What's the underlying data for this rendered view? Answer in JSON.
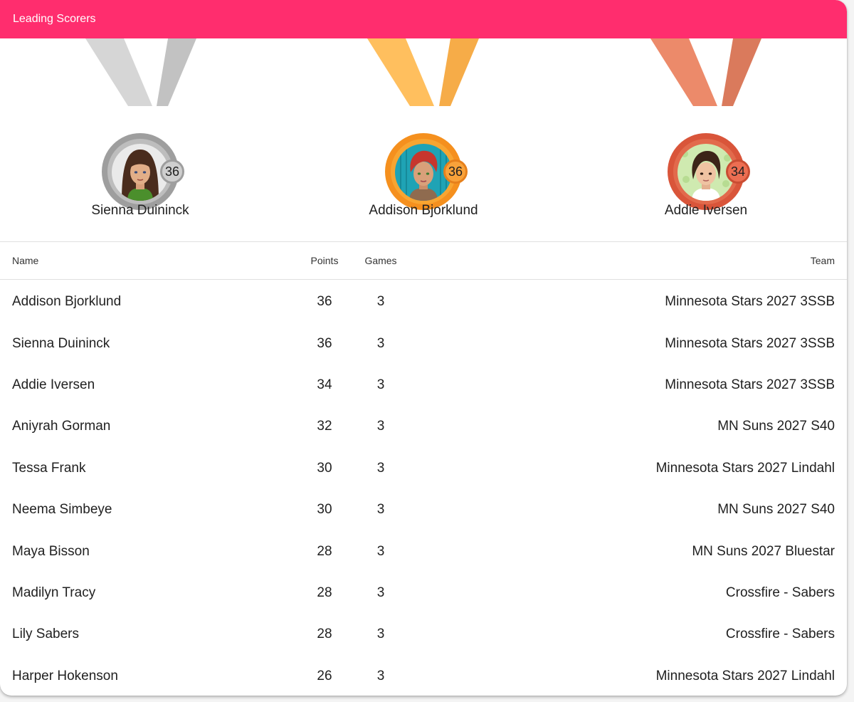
{
  "header": {
    "title": "Leading Scorers"
  },
  "podium": [
    {
      "name": "Sienna Duininck",
      "points": "36",
      "medal": "silver",
      "avatar_icon": "avatar-girl-long-brown-hair-icon",
      "colors": {
        "ribbon_left": "#d6d6d6",
        "ribbon_right": "#c2c2c2",
        "ring": "#9e9e9e",
        "ring_inner": "#bdbdbd",
        "badge": "#cfcfcf",
        "badge_border": "#9e9e9e"
      }
    },
    {
      "name": "Addison Bjorklund",
      "points": "36",
      "medal": "gold",
      "avatar_icon": "avatar-girl-red-hair-icon",
      "colors": {
        "ribbon_left": "#ffbf5e",
        "ribbon_right": "#f6ac48",
        "ring": "#f5901e",
        "ring_inner": "#f8a531",
        "badge": "#f9a23a",
        "badge_border": "#e6801c"
      }
    },
    {
      "name": "Addie Iversen",
      "points": "34",
      "medal": "bronze",
      "avatar_icon": "avatar-girl-dark-bob-hair-icon",
      "colors": {
        "ribbon_left": "#ec8a6a",
        "ribbon_right": "#da7a5c",
        "ring": "#d9553a",
        "ring_inner": "#e26a4c",
        "badge": "#ec6e52",
        "badge_border": "#c94d33"
      }
    }
  ],
  "table": {
    "columns": {
      "name": "Name",
      "points": "Points",
      "games": "Games",
      "team": "Team"
    },
    "rows": [
      {
        "name": "Addison Bjorklund",
        "points": "36",
        "games": "3",
        "team": "Minnesota Stars 2027 3SSB"
      },
      {
        "name": "Sienna Duininck",
        "points": "36",
        "games": "3",
        "team": "Minnesota Stars 2027 3SSB"
      },
      {
        "name": "Addie Iversen",
        "points": "34",
        "games": "3",
        "team": "Minnesota Stars 2027 3SSB"
      },
      {
        "name": "Aniyrah Gorman",
        "points": "32",
        "games": "3",
        "team": "MN Suns 2027 S40"
      },
      {
        "name": "Tessa Frank",
        "points": "30",
        "games": "3",
        "team": "Minnesota Stars 2027 Lindahl"
      },
      {
        "name": "Neema Simbeye",
        "points": "30",
        "games": "3",
        "team": "MN Suns 2027 S40"
      },
      {
        "name": "Maya Bisson",
        "points": "28",
        "games": "3",
        "team": "MN Suns 2027 Bluestar"
      },
      {
        "name": "Madilyn Tracy",
        "points": "28",
        "games": "3",
        "team": "Crossfire - Sabers"
      },
      {
        "name": "Lily Sabers",
        "points": "28",
        "games": "3",
        "team": "Crossfire - Sabers"
      },
      {
        "name": "Harper Hokenson",
        "points": "26",
        "games": "3",
        "team": "Minnesota Stars 2027 Lindahl"
      }
    ]
  }
}
